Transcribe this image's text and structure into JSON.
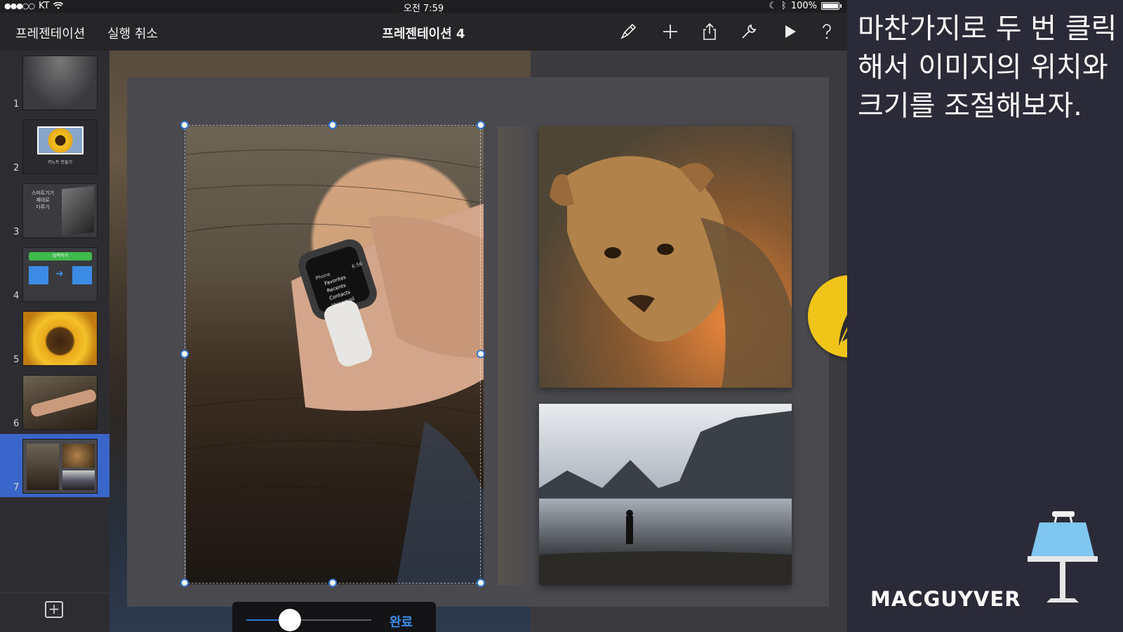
{
  "status_bar": {
    "carrier": "KT",
    "time": "오전 7:59",
    "battery": "100%"
  },
  "toolbar": {
    "presentations_label": "프레젠테이션",
    "undo_label": "실행 취소",
    "title": "프레젠테이션 4"
  },
  "navigator": {
    "slides": [
      {
        "number": "1"
      },
      {
        "number": "2",
        "caption": "키노트 만들기"
      },
      {
        "number": "3",
        "caption": "스마트기기\n제대로\n다루기"
      },
      {
        "number": "4",
        "caption": "입력하기"
      },
      {
        "number": "5"
      },
      {
        "number": "6"
      },
      {
        "number": "7",
        "selected": true
      }
    ],
    "add_label": "+"
  },
  "canvas": {
    "watch_menu": [
      "Favorites",
      "Recents",
      "Contacts",
      "Voicemail"
    ],
    "watch_header": "Phone",
    "watch_time": "6:56",
    "resize_slider_value": 0.35,
    "done_label": "완료"
  },
  "overlay": {
    "caption": "마찬가지로 두 번 클릭해서 이미지의 위치와 크기를 조절해보자.",
    "brand": "MACGUYVER"
  },
  "colors": {
    "accent": "#2f74d6",
    "selected_slide": "#3a66c9",
    "badge": "#f0c419"
  }
}
